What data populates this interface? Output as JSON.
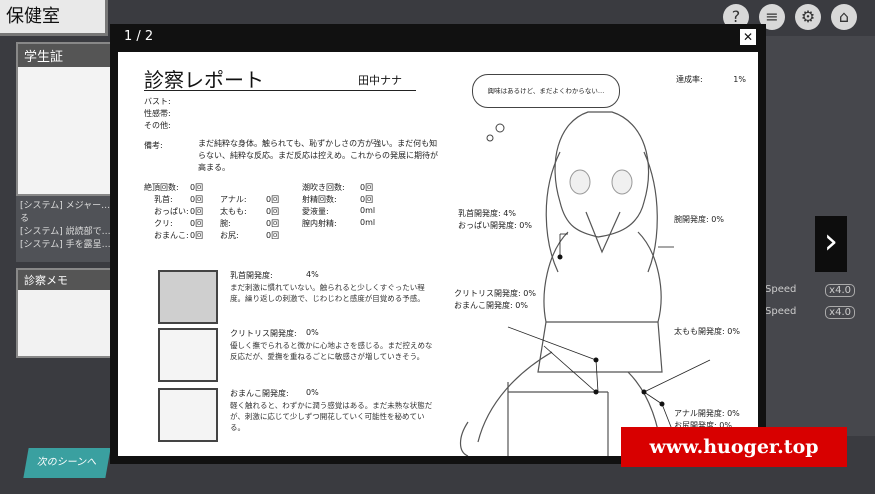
{
  "background": {
    "room_title": "保健室",
    "student_card_title": "学生証",
    "log_lines": [
      "[システム] メジャー…",
      "る",
      "[システム] 説読部で…",
      "[システム] 手を露呈…"
    ],
    "memo_title": "診察メモ",
    "next_scene_label": "次のシーンへ",
    "speed_rows": [
      {
        "label": "Speed",
        "value": "x4.0"
      },
      {
        "label": "Speed",
        "value": "x4.0"
      }
    ]
  },
  "modal": {
    "page_indicator": "1 / 2",
    "close_icon": "close-icon",
    "next_icon": "chevron-right-icon"
  },
  "report": {
    "title": "診察レポート",
    "name": "田中ナナ",
    "fields": [
      "バスト:",
      "性感帯:",
      "その他:"
    ],
    "remark_label": "備考:",
    "remark_text": "まだ純粋な身体。触られても、恥ずかしさの方が強い。まだ何も知らない、純粋な反応。まだ反応は控えめ。これからの発展に期待が高まる。",
    "counts": [
      [
        {
          "label": "絶頂回数:",
          "value": "0回"
        },
        {
          "label": "",
          "value": ""
        },
        {
          "label": "潮吹き回数:",
          "value": "0回"
        }
      ],
      [
        {
          "label": "乳首:",
          "value": "0回"
        },
        {
          "label": "アナル:",
          "value": "0回"
        },
        {
          "label": "射精回数:",
          "value": "0回"
        }
      ],
      [
        {
          "label": "おっぱい:",
          "value": "0回"
        },
        {
          "label": "太もも:",
          "value": "0回"
        },
        {
          "label": "愛液量:",
          "value": "0ml"
        }
      ],
      [
        {
          "label": "クリ:",
          "value": "0回"
        },
        {
          "label": "腕:",
          "value": "0回"
        },
        {
          "label": "膣内射精:",
          "value": "0ml"
        }
      ],
      [
        {
          "label": "おまんこ:",
          "value": "0回"
        },
        {
          "label": "お尻:",
          "value": "0回"
        },
        {
          "label": "",
          "value": ""
        }
      ]
    ],
    "developments": [
      {
        "title": "乳首開発度:",
        "value": "4%",
        "desc": "まだ刺激に慣れていない。触られると少しくすぐったい程度。繰り返しの刺激で、じわじわと感度が目覚める予感。"
      },
      {
        "title": "クリトリス開発度:",
        "value": "0%",
        "desc": "優しく撫でられると微かに心地よさを感じる。まだ控えめな反応だが、愛撫を重ねるごとに敏感さが増していきそう。"
      },
      {
        "title": "おまんこ開発度:",
        "value": "0%",
        "desc": "軽く触れると、わずかに潤う感覚はある。まだ未熟な状態だが、刺激に応じて少しずつ開花していく可能性を秘めている。"
      }
    ]
  },
  "character": {
    "thought": "興味はあるけど、まだよくわからない…",
    "achievement_label": "達成率:",
    "achievement_value": "1%",
    "labels": {
      "nipple": "乳首開発度: 4%",
      "breast": "おっぱい開発度: 0%",
      "arm": "腕開発度: 0%",
      "clit": "クリトリス開発度: 0%",
      "pussy": "おまんこ開発度: 0%",
      "thigh": "太もも開発度: 0%",
      "anal": "アナル開発度: 0%",
      "butt": "お尻開発度: 0%"
    }
  },
  "watermark": "www.huoger.top"
}
